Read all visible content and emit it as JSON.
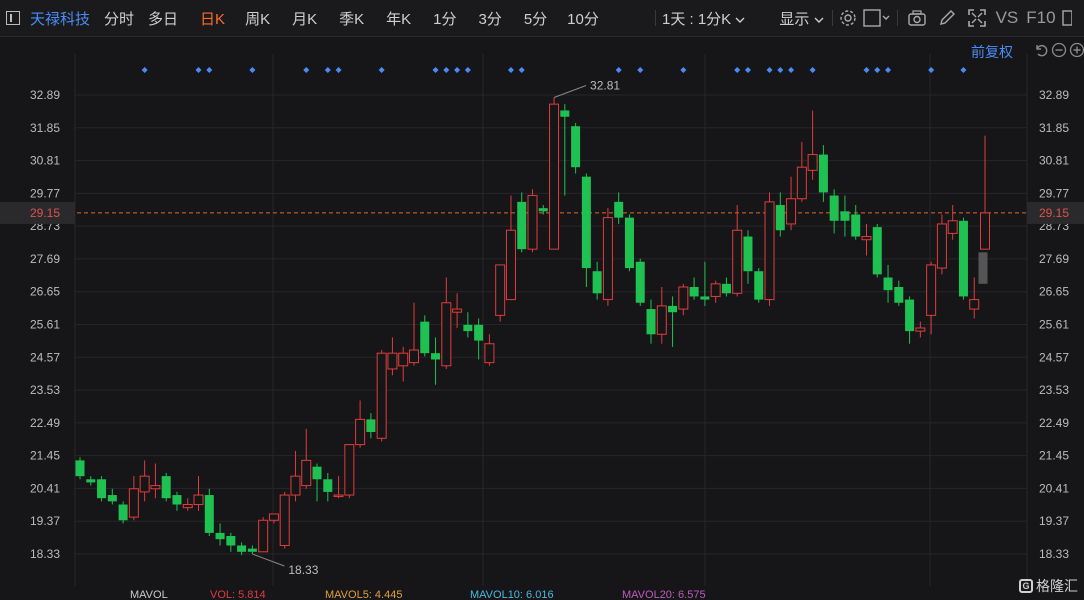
{
  "toolbar": {
    "stock_name": "天禄科技",
    "tabs": [
      {
        "label": "分时",
        "active": false
      },
      {
        "label": "多日",
        "active": false
      },
      {
        "label": "日K",
        "active": true
      },
      {
        "label": "周K",
        "active": false
      },
      {
        "label": "月K",
        "active": false
      },
      {
        "label": "季K",
        "active": false
      },
      {
        "label": "年K",
        "active": false
      },
      {
        "label": "1分",
        "active": false
      },
      {
        "label": "3分",
        "active": false
      },
      {
        "label": "5分",
        "active": false
      },
      {
        "label": "10分",
        "active": false
      }
    ],
    "period_dropdown": "1天 : 1分K",
    "display_dropdown": "显示",
    "vs_label": "VS",
    "f10_label": "F10"
  },
  "overlay": {
    "adjust_label": "前复权"
  },
  "chart_data": {
    "type": "candlestick",
    "y_ticks": [
      "32.89",
      "31.85",
      "30.81",
      "29.77",
      "28.73",
      "27.69",
      "26.65",
      "25.61",
      "24.57",
      "23.53",
      "22.49",
      "21.45",
      "20.41",
      "19.37",
      "18.33"
    ],
    "ylim": [
      17.85,
      33.96
    ],
    "current_price": "29.15",
    "high_label": "32.81",
    "low_label": "18.33",
    "colors": {
      "up": "#e03c3c",
      "down": "#1fc153",
      "current_line": "#e0662b",
      "marker": "#4a8cf7"
    },
    "candles": [
      {
        "o": 21.3,
        "c": 20.8,
        "h": 21.4,
        "l": 20.7
      },
      {
        "o": 20.7,
        "c": 20.6,
        "h": 20.8,
        "l": 20.5
      },
      {
        "o": 20.7,
        "c": 20.1,
        "h": 20.8,
        "l": 20.0
      },
      {
        "o": 20.2,
        "c": 20.0,
        "h": 20.4,
        "l": 19.9
      },
      {
        "o": 19.9,
        "c": 19.4,
        "h": 20.0,
        "l": 19.3
      },
      {
        "o": 19.5,
        "c": 20.4,
        "h": 20.8,
        "l": 19.4
      },
      {
        "o": 20.3,
        "c": 20.8,
        "h": 21.3,
        "l": 20.0
      },
      {
        "o": 20.4,
        "c": 20.5,
        "h": 21.2,
        "l": 20.1
      },
      {
        "o": 20.8,
        "c": 20.1,
        "h": 20.9,
        "l": 20.0
      },
      {
        "o": 20.2,
        "c": 19.9,
        "h": 20.3,
        "l": 19.7
      },
      {
        "o": 19.8,
        "c": 19.9,
        "h": 20.1,
        "l": 19.7
      },
      {
        "o": 19.9,
        "c": 20.2,
        "h": 20.8,
        "l": 19.7
      },
      {
        "o": 20.2,
        "c": 19.0,
        "h": 20.4,
        "l": 18.9
      },
      {
        "o": 19.0,
        "c": 18.8,
        "h": 19.3,
        "l": 18.6
      },
      {
        "o": 18.9,
        "c": 18.6,
        "h": 19.0,
        "l": 18.4
      },
      {
        "o": 18.6,
        "c": 18.4,
        "h": 18.7,
        "l": 18.3
      },
      {
        "o": 18.5,
        "c": 18.4,
        "h": 18.6,
        "l": 18.33
      },
      {
        "o": 18.4,
        "c": 19.4,
        "h": 19.5,
        "l": 18.4
      },
      {
        "o": 19.4,
        "c": 19.6,
        "h": 19.6,
        "l": 19.3
      },
      {
        "o": 18.6,
        "c": 20.2,
        "h": 20.3,
        "l": 18.5
      },
      {
        "o": 20.2,
        "c": 20.8,
        "h": 21.6,
        "l": 20.0
      },
      {
        "o": 20.5,
        "c": 21.3,
        "h": 22.3,
        "l": 20.4
      },
      {
        "o": 21.1,
        "c": 20.7,
        "h": 21.2,
        "l": 20.0
      },
      {
        "o": 20.7,
        "c": 20.3,
        "h": 20.9,
        "l": 20.0
      },
      {
        "o": 20.2,
        "c": 20.2,
        "h": 20.8,
        "l": 20.1
      },
      {
        "o": 20.2,
        "c": 21.8,
        "h": 21.8,
        "l": 20.1
      },
      {
        "o": 21.8,
        "c": 22.6,
        "h": 23.2,
        "l": 21.7
      },
      {
        "o": 22.6,
        "c": 22.2,
        "h": 22.8,
        "l": 22.0
      },
      {
        "o": 22.0,
        "c": 24.7,
        "h": 24.8,
        "l": 21.9
      },
      {
        "o": 24.2,
        "c": 24.7,
        "h": 25.2,
        "l": 24.0
      },
      {
        "o": 24.3,
        "c": 24.7,
        "h": 24.9,
        "l": 23.8
      },
      {
        "o": 24.4,
        "c": 24.8,
        "h": 26.3,
        "l": 24.3
      },
      {
        "o": 25.7,
        "c": 24.7,
        "h": 25.9,
        "l": 24.6
      },
      {
        "o": 24.7,
        "c": 24.5,
        "h": 25.2,
        "l": 23.7
      },
      {
        "o": 24.3,
        "c": 26.3,
        "h": 27.1,
        "l": 24.2
      },
      {
        "o": 26.0,
        "c": 26.1,
        "h": 26.6,
        "l": 25.5
      },
      {
        "o": 25.6,
        "c": 25.4,
        "h": 26.0,
        "l": 25.2
      },
      {
        "o": 25.6,
        "c": 25.1,
        "h": 25.8,
        "l": 24.5
      },
      {
        "o": 24.4,
        "c": 25.0,
        "h": 25.3,
        "l": 24.3
      },
      {
        "o": 25.9,
        "c": 27.5,
        "h": 27.5,
        "l": 25.7
      },
      {
        "o": 26.4,
        "c": 28.6,
        "h": 29.7,
        "l": 26.4
      },
      {
        "o": 29.5,
        "c": 28.0,
        "h": 29.8,
        "l": 27.9
      },
      {
        "o": 28.0,
        "c": 29.7,
        "h": 29.9,
        "l": 27.9
      },
      {
        "o": 29.3,
        "c": 29.2,
        "h": 29.4,
        "l": 29.1
      },
      {
        "o": 28.0,
        "c": 32.6,
        "h": 32.81,
        "l": 28.0
      },
      {
        "o": 32.4,
        "c": 32.2,
        "h": 32.6,
        "l": 29.7
      },
      {
        "o": 31.9,
        "c": 30.6,
        "h": 32.0,
        "l": 30.4
      },
      {
        "o": 30.3,
        "c": 27.4,
        "h": 30.4,
        "l": 26.8
      },
      {
        "o": 27.3,
        "c": 26.6,
        "h": 27.6,
        "l": 26.4
      },
      {
        "o": 26.4,
        "c": 29.0,
        "h": 29.3,
        "l": 26.2
      },
      {
        "o": 29.5,
        "c": 29.0,
        "h": 29.8,
        "l": 28.8
      },
      {
        "o": 29.0,
        "c": 27.4,
        "h": 29.1,
        "l": 27.3
      },
      {
        "o": 27.6,
        "c": 26.3,
        "h": 27.7,
        "l": 26.2
      },
      {
        "o": 26.1,
        "c": 25.3,
        "h": 26.4,
        "l": 25.0
      },
      {
        "o": 25.3,
        "c": 26.2,
        "h": 26.8,
        "l": 25.0
      },
      {
        "o": 26.2,
        "c": 26.0,
        "h": 26.5,
        "l": 24.9
      },
      {
        "o": 26.1,
        "c": 26.8,
        "h": 26.9,
        "l": 25.9
      },
      {
        "o": 26.8,
        "c": 26.5,
        "h": 27.1,
        "l": 26.4
      },
      {
        "o": 26.5,
        "c": 26.4,
        "h": 27.6,
        "l": 26.2
      },
      {
        "o": 26.5,
        "c": 26.9,
        "h": 27.0,
        "l": 26.3
      },
      {
        "o": 26.9,
        "c": 26.6,
        "h": 27.1,
        "l": 26.5
      },
      {
        "o": 26.6,
        "c": 28.6,
        "h": 29.4,
        "l": 26.5
      },
      {
        "o": 28.4,
        "c": 27.3,
        "h": 28.6,
        "l": 26.9
      },
      {
        "o": 27.3,
        "c": 26.4,
        "h": 27.4,
        "l": 26.3
      },
      {
        "o": 26.4,
        "c": 29.5,
        "h": 29.8,
        "l": 26.2
      },
      {
        "o": 29.4,
        "c": 28.6,
        "h": 29.8,
        "l": 28.4
      },
      {
        "o": 28.8,
        "c": 29.6,
        "h": 30.3,
        "l": 28.6
      },
      {
        "o": 29.6,
        "c": 30.6,
        "h": 31.4,
        "l": 29.5
      },
      {
        "o": 30.5,
        "c": 31.0,
        "h": 32.4,
        "l": 30.2
      },
      {
        "o": 31.0,
        "c": 29.8,
        "h": 31.3,
        "l": 29.5
      },
      {
        "o": 29.7,
        "c": 28.9,
        "h": 29.9,
        "l": 28.5
      },
      {
        "o": 29.2,
        "c": 28.9,
        "h": 29.7,
        "l": 28.4
      },
      {
        "o": 29.1,
        "c": 28.4,
        "h": 29.4,
        "l": 28.3
      },
      {
        "o": 28.3,
        "c": 28.4,
        "h": 28.8,
        "l": 27.8
      },
      {
        "o": 28.7,
        "c": 27.2,
        "h": 28.8,
        "l": 27.1
      },
      {
        "o": 27.1,
        "c": 26.7,
        "h": 27.5,
        "l": 26.3
      },
      {
        "o": 26.8,
        "c": 26.3,
        "h": 27.0,
        "l": 26.2
      },
      {
        "o": 26.4,
        "c": 25.4,
        "h": 26.5,
        "l": 25.0
      },
      {
        "o": 25.4,
        "c": 25.5,
        "h": 25.7,
        "l": 25.2
      },
      {
        "o": 25.9,
        "c": 27.5,
        "h": 27.6,
        "l": 25.3
      },
      {
        "o": 27.4,
        "c": 28.8,
        "h": 29.1,
        "l": 27.2
      },
      {
        "o": 28.5,
        "c": 28.9,
        "h": 29.4,
        "l": 28.3
      },
      {
        "o": 28.9,
        "c": 26.5,
        "h": 29.0,
        "l": 26.4
      },
      {
        "o": 26.1,
        "c": 26.4,
        "h": 27.1,
        "l": 25.8
      },
      {
        "o": 28.0,
        "c": 29.15,
        "h": 31.6,
        "l": 28.0
      }
    ],
    "markers_at": [
      6,
      11,
      12,
      16,
      21,
      23,
      24,
      28,
      33,
      34,
      35,
      36,
      40,
      41,
      50,
      52,
      56,
      61,
      62,
      64,
      65,
      66,
      68,
      73,
      74,
      75,
      79,
      82
    ]
  },
  "volume_bar": [
    {
      "label": "MAVOL",
      "color": "#c9c9c9"
    },
    {
      "label": "VOL: 5.814",
      "color": "#e03c3c"
    },
    {
      "label": "MAVOL5: 4.445",
      "color": "#e0a03c"
    },
    {
      "label": "MAVOL10: 6.016",
      "color": "#4ab8e0"
    },
    {
      "label": "MAVOL20: 6.575",
      "color": "#c05ac0"
    }
  ],
  "watermark": {
    "text": "格隆汇",
    "logo": "G"
  }
}
